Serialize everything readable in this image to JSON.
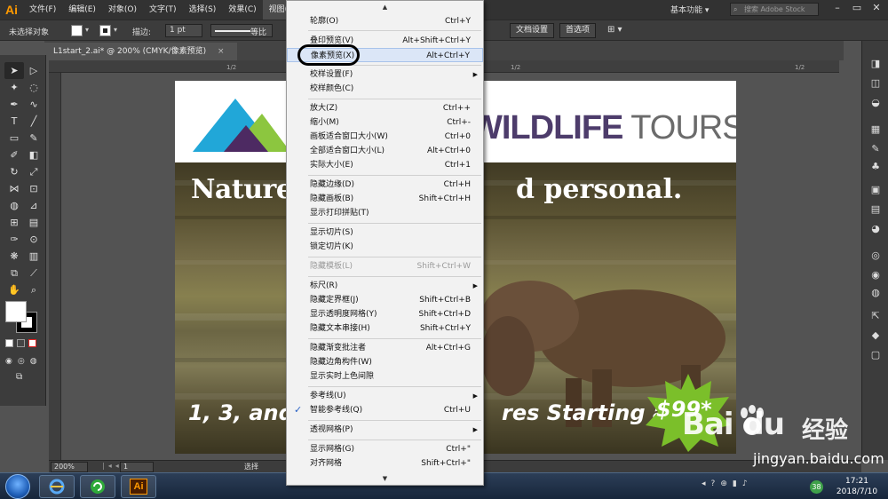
{
  "app": {
    "logo": "Ai"
  },
  "menubar": {
    "items": [
      "文件(F)",
      "编辑(E)",
      "对象(O)",
      "文字(T)",
      "选择(S)",
      "效果(C)",
      "视图(V)"
    ],
    "workspace": "基本功能",
    "search_placeholder": "搜索 Adobe Stock"
  },
  "controlbar": {
    "selection": "未选择对象",
    "stroke_label": "描边:",
    "stroke_value": "1 pt",
    "stroke_style": "等比",
    "doc_settings": "文档设置",
    "preferences": "首选项"
  },
  "document": {
    "tab_title": "L1start_2.ai* @ 200% (CMYK/像素预览)",
    "close": "×"
  },
  "ruler": {
    "ticks": [
      "1/2",
      "1/2",
      "1/2"
    ]
  },
  "artboard": {
    "logo_text_bold": "WILDLIFE",
    "logo_text_light": " TOURS",
    "logo_initial": "M",
    "headline_a": "Nature",
    "headline_b": "d personal.",
    "footer_a": "1, 3, and",
    "footer_b": "res Starting at",
    "price": "$99*"
  },
  "view_menu": {
    "items": [
      {
        "label": "轮廓(O)",
        "shortcut": "Ctrl+Y"
      },
      {
        "label": "叠印预览(V)",
        "shortcut": "Alt+Shift+Ctrl+Y"
      },
      {
        "label": "像素预览(X)",
        "shortcut": "Alt+Ctrl+Y"
      },
      {
        "label": "校样设置(F)",
        "shortcut": ""
      },
      {
        "label": "校样颜色(C)",
        "shortcut": ""
      },
      {
        "label": "放大(Z)",
        "shortcut": "Ctrl++"
      },
      {
        "label": "缩小(M)",
        "shortcut": "Ctrl+-"
      },
      {
        "label": "画板适合窗口大小(W)",
        "shortcut": "Ctrl+0"
      },
      {
        "label": "全部适合窗口大小(L)",
        "shortcut": "Alt+Ctrl+0"
      },
      {
        "label": "实际大小(E)",
        "shortcut": "Ctrl+1"
      },
      {
        "label": "隐藏边缘(D)",
        "shortcut": "Ctrl+H"
      },
      {
        "label": "隐藏画板(B)",
        "shortcut": "Shift+Ctrl+H"
      },
      {
        "label": "显示打印拼贴(T)",
        "shortcut": ""
      },
      {
        "label": "显示切片(S)",
        "shortcut": ""
      },
      {
        "label": "锁定切片(K)",
        "shortcut": ""
      },
      {
        "label": "隐藏模板(L)",
        "shortcut": "Shift+Ctrl+W"
      },
      {
        "label": "标尺(R)",
        "shortcut": ""
      },
      {
        "label": "隐藏定界框(J)",
        "shortcut": "Shift+Ctrl+B"
      },
      {
        "label": "显示透明度网格(Y)",
        "shortcut": "Shift+Ctrl+D"
      },
      {
        "label": "隐藏文本串接(H)",
        "shortcut": "Shift+Ctrl+Y"
      },
      {
        "label": "隐藏渐变批注者",
        "shortcut": "Alt+Ctrl+G"
      },
      {
        "label": "隐藏边角构件(W)",
        "shortcut": ""
      },
      {
        "label": "显示实时上色间隙",
        "shortcut": ""
      },
      {
        "label": "参考线(U)",
        "shortcut": ""
      },
      {
        "label": "智能参考线(Q)",
        "shortcut": "Ctrl+U"
      },
      {
        "label": "透视网格(P)",
        "shortcut": ""
      },
      {
        "label": "显示网格(G)",
        "shortcut": "Ctrl+\""
      },
      {
        "label": "对齐网格",
        "shortcut": "Shift+Ctrl+\""
      }
    ]
  },
  "statusbar": {
    "zoom": "200%",
    "page": "1",
    "status": "选择"
  },
  "taskbar": {
    "time": "17:21",
    "date": "2018/7/10",
    "badge": "38"
  },
  "watermark": {
    "brand": "Bai  du",
    "jingyan": "经验",
    "url": "jingyan.baidu.com"
  }
}
